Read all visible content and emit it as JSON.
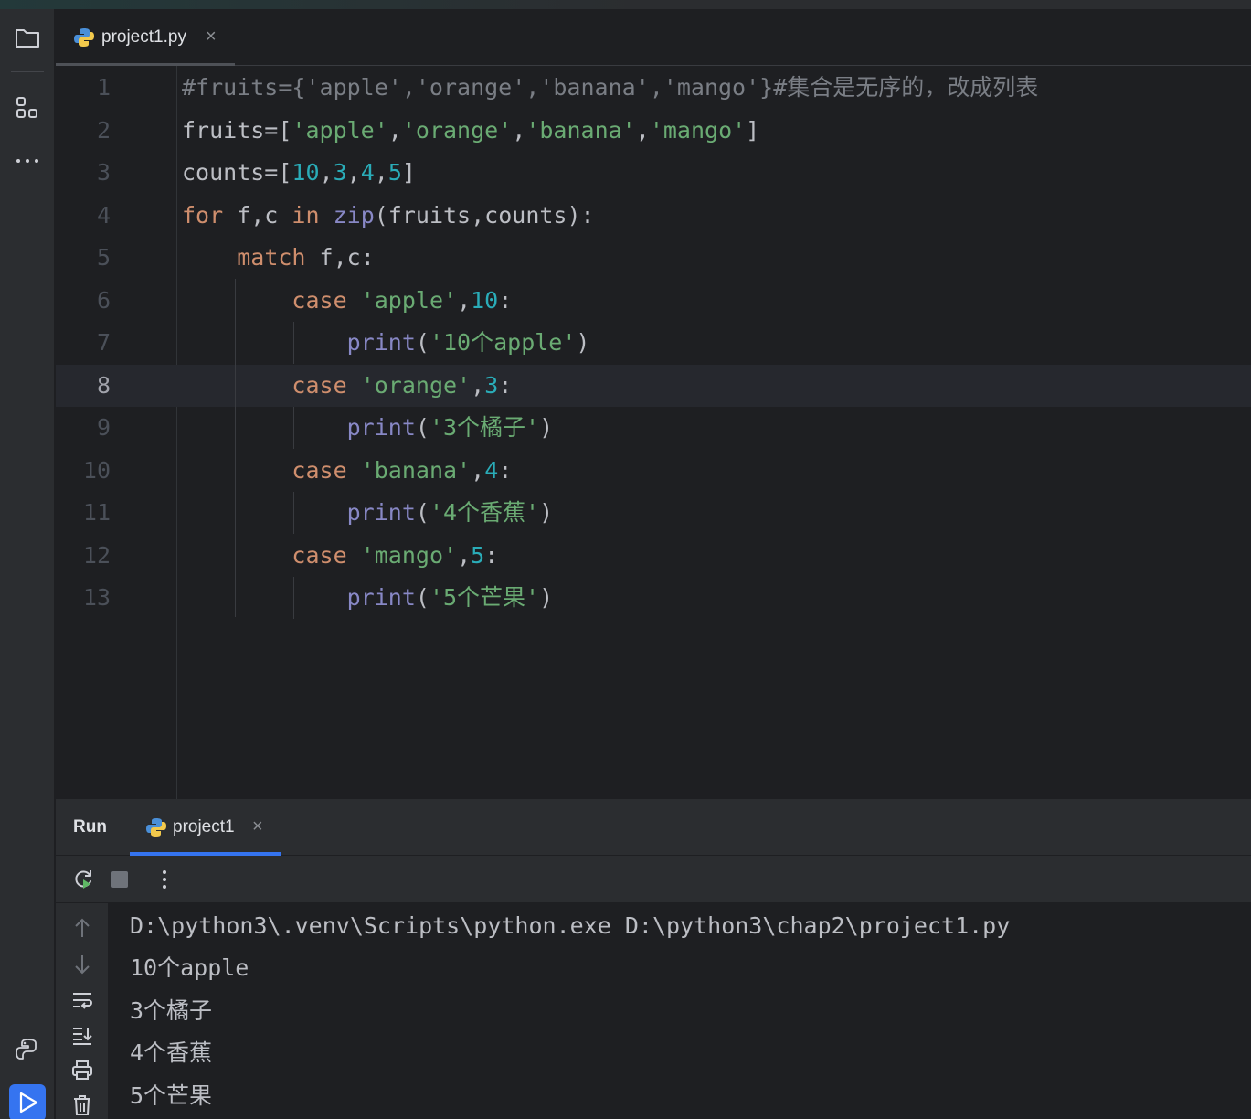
{
  "editor": {
    "tab": {
      "filename": "project1.py",
      "close": "×"
    },
    "lines": [
      {
        "n": "1",
        "tokens": [
          {
            "t": "#fruits={'apple','orange','banana','mango'}#集合是无序的，改成列表",
            "c": "cm"
          }
        ]
      },
      {
        "n": "2",
        "tokens": [
          {
            "t": "fruits=[",
            "c": ""
          },
          {
            "t": "'apple'",
            "c": "st"
          },
          {
            "t": ",",
            "c": ""
          },
          {
            "t": "'orange'",
            "c": "st"
          },
          {
            "t": ",",
            "c": ""
          },
          {
            "t": "'banana'",
            "c": "st"
          },
          {
            "t": ",",
            "c": ""
          },
          {
            "t": "'mango'",
            "c": "st"
          },
          {
            "t": "]",
            "c": ""
          }
        ]
      },
      {
        "n": "3",
        "tokens": [
          {
            "t": "counts=[",
            "c": ""
          },
          {
            "t": "10",
            "c": "nm"
          },
          {
            "t": ",",
            "c": ""
          },
          {
            "t": "3",
            "c": "nm"
          },
          {
            "t": ",",
            "c": ""
          },
          {
            "t": "4",
            "c": "nm"
          },
          {
            "t": ",",
            "c": ""
          },
          {
            "t": "5",
            "c": "nm"
          },
          {
            "t": "]",
            "c": ""
          }
        ]
      },
      {
        "n": "4",
        "tokens": [
          {
            "t": "for",
            "c": "kw"
          },
          {
            "t": " f,c ",
            "c": ""
          },
          {
            "t": "in",
            "c": "kw"
          },
          {
            "t": " ",
            "c": ""
          },
          {
            "t": "zip",
            "c": "bi"
          },
          {
            "t": "(fruits,counts):",
            "c": ""
          }
        ]
      },
      {
        "n": "5",
        "tokens": [
          {
            "t": "    ",
            "c": ""
          },
          {
            "t": "match",
            "c": "kw"
          },
          {
            "t": " f,c:",
            "c": ""
          }
        ]
      },
      {
        "n": "6",
        "tokens": [
          {
            "t": "        ",
            "c": ""
          },
          {
            "t": "case",
            "c": "kw"
          },
          {
            "t": " ",
            "c": ""
          },
          {
            "t": "'apple'",
            "c": "st"
          },
          {
            "t": ",",
            "c": ""
          },
          {
            "t": "10",
            "c": "nm"
          },
          {
            "t": ":",
            "c": ""
          }
        ]
      },
      {
        "n": "7",
        "tokens": [
          {
            "t": "            ",
            "c": ""
          },
          {
            "t": "print",
            "c": "bi"
          },
          {
            "t": "(",
            "c": ""
          },
          {
            "t": "'10个apple'",
            "c": "st"
          },
          {
            "t": ")",
            "c": ""
          }
        ]
      },
      {
        "n": "8",
        "tokens": [
          {
            "t": "        ",
            "c": ""
          },
          {
            "t": "case",
            "c": "kw"
          },
          {
            "t": " ",
            "c": ""
          },
          {
            "t": "'orange'",
            "c": "st"
          },
          {
            "t": ",",
            "c": ""
          },
          {
            "t": "3",
            "c": "nm"
          },
          {
            "t": ":",
            "c": ""
          }
        ]
      },
      {
        "n": "9",
        "tokens": [
          {
            "t": "            ",
            "c": ""
          },
          {
            "t": "print",
            "c": "bi"
          },
          {
            "t": "(",
            "c": ""
          },
          {
            "t": "'3个橘子'",
            "c": "st"
          },
          {
            "t": ")",
            "c": ""
          }
        ]
      },
      {
        "n": "10",
        "tokens": [
          {
            "t": "        ",
            "c": ""
          },
          {
            "t": "case",
            "c": "kw"
          },
          {
            "t": " ",
            "c": ""
          },
          {
            "t": "'banana'",
            "c": "st"
          },
          {
            "t": ",",
            "c": ""
          },
          {
            "t": "4",
            "c": "nm"
          },
          {
            "t": ":",
            "c": ""
          }
        ]
      },
      {
        "n": "11",
        "tokens": [
          {
            "t": "            ",
            "c": ""
          },
          {
            "t": "print",
            "c": "bi"
          },
          {
            "t": "(",
            "c": ""
          },
          {
            "t": "'4个香蕉'",
            "c": "st"
          },
          {
            "t": ")",
            "c": ""
          }
        ]
      },
      {
        "n": "12",
        "tokens": [
          {
            "t": "        ",
            "c": ""
          },
          {
            "t": "case",
            "c": "kw"
          },
          {
            "t": " ",
            "c": ""
          },
          {
            "t": "'mango'",
            "c": "st"
          },
          {
            "t": ",",
            "c": ""
          },
          {
            "t": "5",
            "c": "nm"
          },
          {
            "t": ":",
            "c": ""
          }
        ]
      },
      {
        "n": "13",
        "tokens": [
          {
            "t": "            ",
            "c": ""
          },
          {
            "t": "print",
            "c": "bi"
          },
          {
            "t": "(",
            "c": ""
          },
          {
            "t": "'5个芒果'",
            "c": "st"
          },
          {
            "t": ")",
            "c": ""
          }
        ]
      }
    ],
    "current_line": "8"
  },
  "run": {
    "title": "Run",
    "tab": {
      "name": "project1",
      "close": "×"
    },
    "output": [
      "D:\\python3\\.venv\\Scripts\\python.exe D:\\python3\\chap2\\project1.py",
      "10个apple",
      "3个橘子",
      "4个香蕉",
      "5个芒果"
    ]
  },
  "icons": {
    "left_toolbar": [
      "folder-icon",
      "structure-icon",
      "more-icon",
      "python-console-icon",
      "run-icon"
    ],
    "run_toolbar": [
      "rerun-icon",
      "stop-icon",
      "options-icon"
    ],
    "run_side": [
      "scroll-up-icon",
      "scroll-down-icon",
      "soft-wrap-icon",
      "scroll-to-end-icon",
      "print-icon",
      "clear-icon"
    ]
  },
  "colors": {
    "background": "#1e1f22",
    "panel": "#2b2d30",
    "keyword": "#cf8e6d",
    "string": "#6aab73",
    "number": "#2aacb8",
    "builtin": "#8888c6",
    "comment": "#7a7e85",
    "accent": "#3574f0"
  }
}
